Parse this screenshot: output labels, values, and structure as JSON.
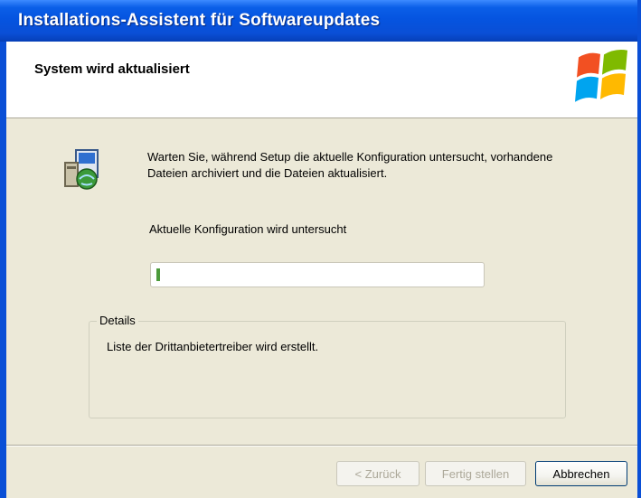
{
  "window": {
    "title": "Installations-Assistent für Softwareupdates"
  },
  "header": {
    "title": "System wird aktualisiert"
  },
  "content": {
    "message": "Warten Sie, während Setup die aktuelle Konfiguration untersucht, vorhandene Dateien archiviert und die Dateien aktualisiert.",
    "status": "Aktuelle Konfiguration wird untersucht",
    "progress_fraction": 0.01
  },
  "details": {
    "legend": "Details",
    "text": "Liste der Drittanbietertreiber wird erstellt."
  },
  "buttons": {
    "back": "< Zurück",
    "finish": "Fertig stellen",
    "cancel": "Abbrechen"
  },
  "icons": {
    "logo": "windows-logo-icon",
    "setup": "setup-package-icon"
  }
}
